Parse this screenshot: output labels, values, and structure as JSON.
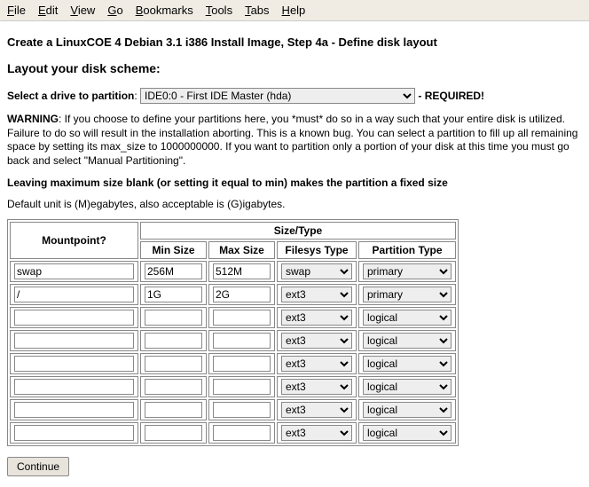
{
  "menubar": [
    {
      "accel": "F",
      "rest": "ile"
    },
    {
      "accel": "E",
      "rest": "dit"
    },
    {
      "accel": "V",
      "rest": "iew"
    },
    {
      "accel": "G",
      "rest": "o"
    },
    {
      "accel": "B",
      "rest": "ookmarks"
    },
    {
      "accel": "T",
      "rest": "ools"
    },
    {
      "accel": "T",
      "rest": "abs"
    },
    {
      "accel": "H",
      "rest": "elp"
    }
  ],
  "title": "Create a LinuxCOE 4 Debian 3.1 i386 Install Image, Step 4a - Define disk layout",
  "subtitle": "Layout your disk scheme:",
  "drive_label": "Select a drive to partition",
  "drive_selected": "IDE0:0 - First IDE Master (hda)",
  "required_suffix": "- REQUIRED!",
  "warning_label": "WARNING",
  "warning_text": ": If you choose to define your partitions here, you *must* do so in a way such that your entire disk is utilized. Failure to do so will result in the installation aborting. This is a known bug. You can select a partition to fill up all remaining space by setting its max_size to 1000000000. If you want to partition only a portion of your disk at this time you must go back and select \"Manual Partitioning\".",
  "fixed_note": "Leaving maximum size blank (or setting it equal to min) makes the partition a fixed size",
  "unit_note": "Default unit is (M)egabytes, also acceptable is (G)igabytes.",
  "table": {
    "mountpoint_header": "Mountpoint?",
    "sizetype_header": "Size/Type",
    "min_header": "Min Size",
    "max_header": "Max Size",
    "fs_header": "Filesys Type",
    "pt_header": "Partition Type",
    "rows": [
      {
        "mount": "swap",
        "min": "256M",
        "max": "512M",
        "fs": "swap",
        "pt": "primary"
      },
      {
        "mount": "/",
        "min": "1G",
        "max": "2G",
        "fs": "ext3",
        "pt": "primary"
      },
      {
        "mount": "",
        "min": "",
        "max": "",
        "fs": "ext3",
        "pt": "logical"
      },
      {
        "mount": "",
        "min": "",
        "max": "",
        "fs": "ext3",
        "pt": "logical"
      },
      {
        "mount": "",
        "min": "",
        "max": "",
        "fs": "ext3",
        "pt": "logical"
      },
      {
        "mount": "",
        "min": "",
        "max": "",
        "fs": "ext3",
        "pt": "logical"
      },
      {
        "mount": "",
        "min": "",
        "max": "",
        "fs": "ext3",
        "pt": "logical"
      },
      {
        "mount": "",
        "min": "",
        "max": "",
        "fs": "ext3",
        "pt": "logical"
      }
    ]
  },
  "continue_label": "Continue"
}
